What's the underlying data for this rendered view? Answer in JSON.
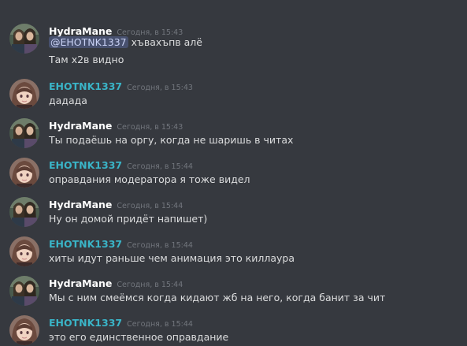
{
  "messages": [
    {
      "author": "HydraMane",
      "time": "Сегодня, в 15:43",
      "lines": [
        {
          "mention": "@EHOTNK1337",
          "text": " хъвахъпв алё"
        },
        {
          "text": "Там х2в видно"
        }
      ]
    },
    {
      "author": "EHOTNK1337",
      "time": "Сегодня, в 15:43",
      "lines": [
        {
          "text": "дадада"
        }
      ]
    },
    {
      "author": "HydraMane",
      "time": "Сегодня, в 15:43",
      "lines": [
        {
          "text": "Ты подаёшь на оргу, когда не шаришь в читах"
        }
      ]
    },
    {
      "author": "EHOTNK1337",
      "time": "Сегодня, в 15:44",
      "lines": [
        {
          "text": "оправдания модератора я тоже видел"
        }
      ]
    },
    {
      "author": "HydraMane",
      "time": "Сегодня, в 15:44",
      "lines": [
        {
          "text": "Ну он домой придёт напишет)"
        }
      ]
    },
    {
      "author": "EHOTNK1337",
      "time": "Сегодня, в 15:44",
      "lines": [
        {
          "text": "хиты идут раньше чем анимация это киллаура"
        }
      ]
    },
    {
      "author": "HydraMane",
      "time": "Сегодня, в 15:44",
      "lines": [
        {
          "text": "Мы с ним смеёмся когда кидают жб на него, когда банит за чит"
        }
      ]
    },
    {
      "author": "EHOTNK1337",
      "time": "Сегодня, в 15:44",
      "lines": [
        {
          "text": "это его единственное оправдание"
        }
      ]
    }
  ],
  "colors": {
    "background": "#36393f",
    "hydra_name": "#ffffff",
    "ehot_name": "#3ab4c7",
    "message_text": "#dcddde",
    "timestamp": "#72767d",
    "mention_bg": "#4e5a8a"
  },
  "icons": {
    "hydra_avatar": "avatar-two-people-photo",
    "ehot_avatar": "avatar-anime-girl"
  }
}
